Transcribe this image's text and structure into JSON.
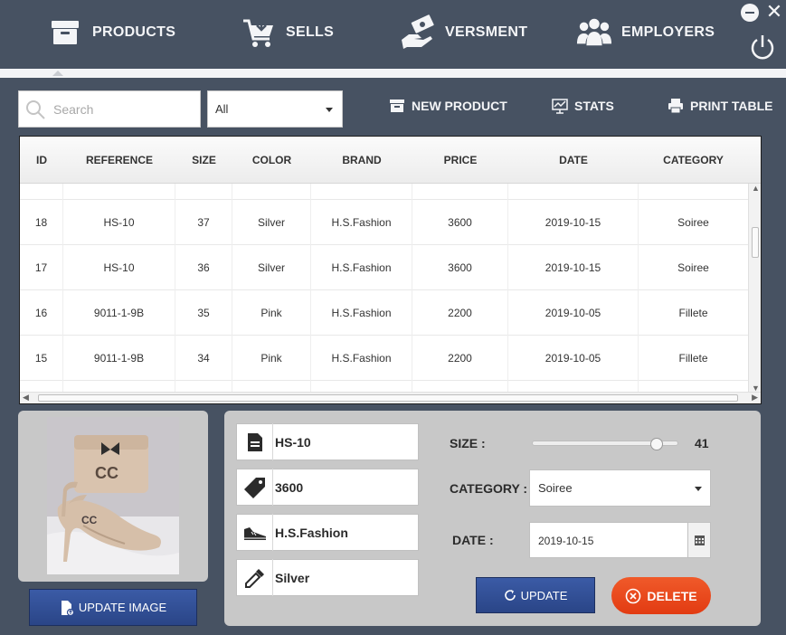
{
  "nav": {
    "products": "PRODUCTS",
    "sells": "SELLS",
    "versment": "VERSMENT",
    "employers": "EMPLOYERS"
  },
  "toolbar": {
    "search_placeholder": "Search",
    "filter_value": "All",
    "new_product": "NEW PRODUCT",
    "stats": "STATS",
    "print_table": "PRINT TABLE"
  },
  "table": {
    "columns": [
      "ID",
      "REFERENCE",
      "SIZE",
      "COLOR",
      "BRAND",
      "PRICE",
      "DATE",
      "CATEGORY"
    ],
    "rows": [
      [
        "18",
        "HS-10",
        "37",
        "Silver",
        "H.S.Fashion",
        "3600",
        "2019-10-15",
        "Soiree"
      ],
      [
        "17",
        "HS-10",
        "36",
        "Silver",
        "H.S.Fashion",
        "3600",
        "2019-10-15",
        "Soiree"
      ],
      [
        "16",
        "9011-1-9B",
        "35",
        "Pink",
        "H.S.Fashion",
        "2200",
        "2019-10-05",
        "Fillete"
      ],
      [
        "15",
        "9011-1-9B",
        "34",
        "Pink",
        "H.S.Fashion",
        "2200",
        "2019-10-05",
        "Fillete"
      ]
    ]
  },
  "detail": {
    "reference": "HS-10",
    "price": "3600",
    "brand": "H.S.Fashion",
    "color": "Silver",
    "size_label": "SIZE :",
    "size_value": "41",
    "size_slider_fraction": 0.85,
    "category_label": "CATEGORY :",
    "category_value": "Soiree",
    "date_label": "DATE :",
    "date_value": "2019-10-15",
    "update_image": "UPDATE IMAGE",
    "update": "UPDATE",
    "delete": "DELETE"
  },
  "colors": {
    "background": "#475262",
    "button_blue": "#2f4b92",
    "delete_red": "#e84a1c",
    "panel_gray": "#c8c8c8"
  }
}
